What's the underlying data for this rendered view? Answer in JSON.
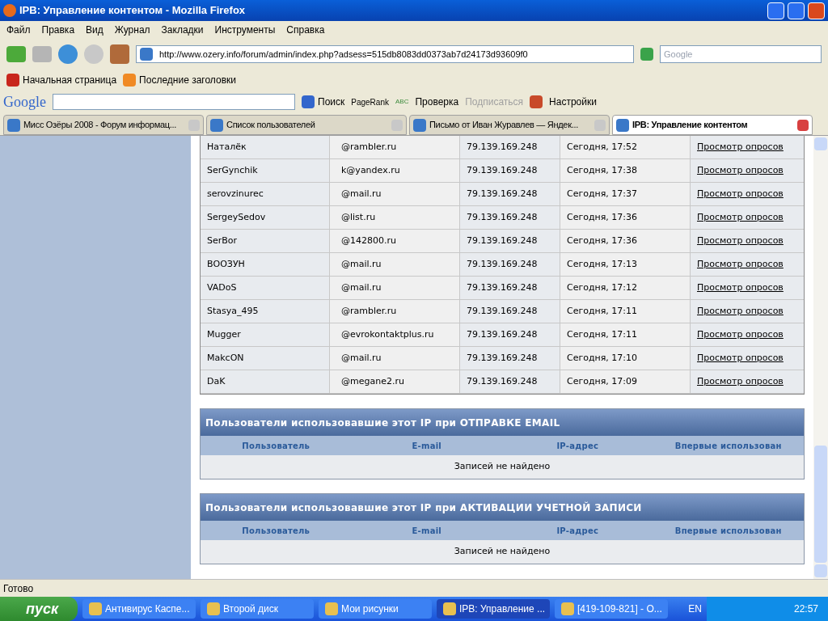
{
  "window": {
    "title": "IPB: Управление контентом - Mozilla Firefox"
  },
  "menu": [
    "Файл",
    "Правка",
    "Вид",
    "Журнал",
    "Закладки",
    "Инструменты",
    "Справка"
  ],
  "address": {
    "value": "http://www.ozery.info/forum/admin/index.php?adsess=515db8083dd0373ab7d24173d93609f0"
  },
  "search": {
    "placeholder": "Google"
  },
  "bookmarks": [
    "Начальная страница",
    "Последние заголовки"
  ],
  "google_toolbar": {
    "logo": "Google",
    "search": "Поиск",
    "pagerank": "PageRank",
    "abc": "ABC",
    "check": "Проверка",
    "subscribe": "Подписаться",
    "settings": "Настройки"
  },
  "tabs": [
    {
      "label": "Мисс Озёры 2008 - Форум информац...",
      "selected": false
    },
    {
      "label": "Список пользователей",
      "selected": false
    },
    {
      "label": "Письмо от Иван Журавлев — Яндек...",
      "selected": false
    },
    {
      "label": "IPB: Управление контентом",
      "selected": true
    }
  ],
  "users_table": {
    "rows": [
      {
        "user": "Наталёк",
        "email": "@rambler.ru",
        "ip": "79.139.169.248",
        "time": "Сегодня, 17:52",
        "link": "Просмотр опросов"
      },
      {
        "user": "SerGynchik",
        "email": "k@yandex.ru",
        "ip": "79.139.169.248",
        "time": "Сегодня, 17:38",
        "link": "Просмотр опросов"
      },
      {
        "user": "serovzinurec",
        "email": "@mail.ru",
        "ip": "79.139.169.248",
        "time": "Сегодня, 17:37",
        "link": "Просмотр опросов"
      },
      {
        "user": "SergeySedov",
        "email": "@list.ru",
        "ip": "79.139.169.248",
        "time": "Сегодня, 17:36",
        "link": "Просмотр опросов"
      },
      {
        "user": "SerBor",
        "email": "@142800.ru",
        "ip": "79.139.169.248",
        "time": "Сегодня, 17:36",
        "link": "Просмотр опросов"
      },
      {
        "user": "ВООЗУН",
        "email": "@mail.ru",
        "ip": "79.139.169.248",
        "time": "Сегодня, 17:13",
        "link": "Просмотр опросов"
      },
      {
        "user": "VADoS",
        "email": "@mail.ru",
        "ip": "79.139.169.248",
        "time": "Сегодня, 17:12",
        "link": "Просмотр опросов"
      },
      {
        "user": "Stasya_495",
        "email": "@rambler.ru",
        "ip": "79.139.169.248",
        "time": "Сегодня, 17:11",
        "link": "Просмотр опросов"
      },
      {
        "user": "Mugger",
        "email": "@evrokontaktplus.ru",
        "ip": "79.139.169.248",
        "time": "Сегодня, 17:11",
        "link": "Просмотр опросов"
      },
      {
        "user": "MakcON",
        "email": "@mail.ru",
        "ip": "79.139.169.248",
        "time": "Сегодня, 17:10",
        "link": "Просмотр опросов"
      },
      {
        "user": "DaK",
        "email": "@megane2.ru",
        "ip": "79.139.169.248",
        "time": "Сегодня, 17:09",
        "link": "Просмотр опросов"
      }
    ]
  },
  "sections": [
    {
      "title": "Пользователи использовавшие этот IP при ОТПРАВКЕ EMAIL",
      "columns": [
        "Пользователь",
        "E-mail",
        "IP-адрес",
        "Впервые использован"
      ],
      "empty": "Записей не найдено"
    },
    {
      "title": "Пользователи использовавшие этот IP при АКТИВАЦИИ УЧЕТНОЙ ЗАПИСИ",
      "columns": [
        "Пользователь",
        "E-mail",
        "IP-адрес",
        "Впервые использован"
      ],
      "empty": "Записей не найдено"
    }
  ],
  "status_bar": "Готово",
  "taskbar": {
    "start": "пуск",
    "items": [
      {
        "label": "Антивирус Каспе...",
        "selected": false
      },
      {
        "label": "Второй диск",
        "selected": false
      },
      {
        "label": "Мои рисунки",
        "selected": false
      },
      {
        "label": "IPB: Управление ...",
        "selected": true
      },
      {
        "label": "[419-109-821] - О...",
        "selected": false
      }
    ],
    "lang": "EN",
    "clock": "22:57"
  }
}
